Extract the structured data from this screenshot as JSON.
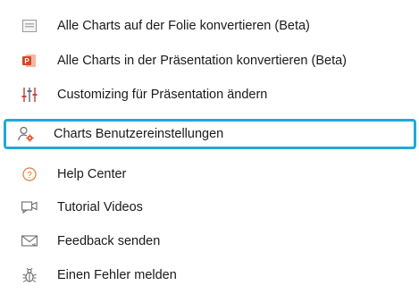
{
  "menu": {
    "items": [
      {
        "label": "Alle Charts auf der Folie konvertieren (Beta)",
        "icon": "slide-icon"
      },
      {
        "label": "Alle Charts in der Präsentation konvertieren (Beta)",
        "icon": "powerpoint-icon"
      },
      {
        "label": "Customizing für Präsentation ändern",
        "icon": "sliders-icon"
      },
      {
        "label": "Charts Benutzereinstellungen",
        "icon": "user-settings-icon",
        "highlighted": true
      },
      {
        "label": "Help Center",
        "icon": "help-icon"
      },
      {
        "label": "Tutorial Videos",
        "icon": "video-icon"
      },
      {
        "label": "Feedback senden",
        "icon": "mail-icon"
      },
      {
        "label": "Einen Fehler melden",
        "icon": "bug-icon"
      }
    ]
  },
  "colors": {
    "highlight_border": "#1eaad8",
    "powerpoint_red": "#d24726",
    "sliders_red": "#c9453c",
    "user_settings_orange": "#e4572e",
    "icon_gray": "#8a8a8a"
  }
}
